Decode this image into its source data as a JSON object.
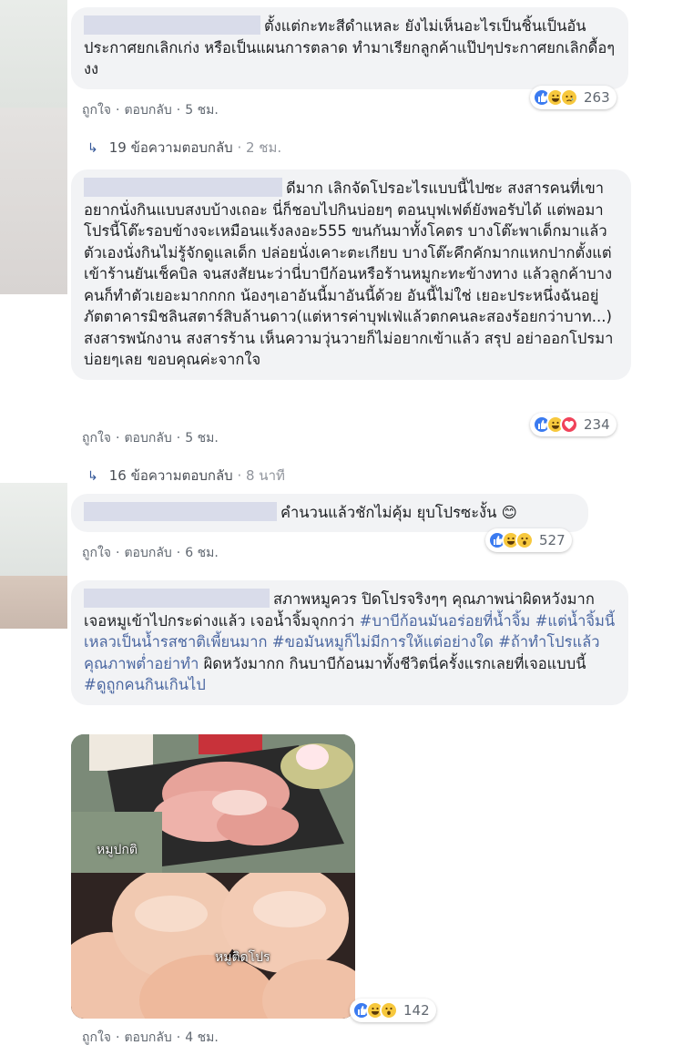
{
  "comments": [
    {
      "text": "ตั้งแต่กะทะสีดำแหละ ยังไม่เห็นอะไรเป็นชิ้นเป็นอัน ประกาศยกเลิกเก่ง หรือเป็นแผนการตลาด ทำมาเรียกลูกค้าแป๊ปๆประกาศยกเลิกดื้อๆ งง",
      "like": "ถูกใจ",
      "reply": "ตอบกลับ",
      "time": "5 ชม.",
      "reactions": [
        "like",
        "haha",
        "sad"
      ],
      "reaction_count": "263",
      "replies": {
        "count": "19 ข้อความตอบกลับ",
        "time": "2 ชม."
      }
    },
    {
      "text": "ดีมาก เลิกจัดโปรอะไรแบบนี้ไปซะ สงสารคนที่เขาอยากนั่งกินแบบสงบบ้างเถอะ นี่ก็ชอบไปกินบ่อยๆ ตอนบุฟเฟต์ยังพอรับได้ แต่พอมาโปรนี้โต๊ะรอบข้างจะเหมือนแร้งลงอะ555 ขนกันมาทั้งโคตร บางโต๊ะพาเด็กมาแล้วตัวเองนั่งกินไม่รู้จักดูแลเด็ก ปล่อยนั่งเคาะตะเกียบ บางโต๊ะคึกคักมากแหกปากตั้งแต่เข้าร้านยันเช็คบิล จนสงสัยนะว่านี่บาบีก้อนหรือร้านหมูกะทะข้างทาง แล้วลูกค้าบางคนก็ทำตัวเยอะมากกกก น้องๆเอาอันนี้มาอันนี้ด้วย อันนี้ไม่ใช่ เยอะประหนึ่งฉันอยู่ภัตตาคารมิชลินสตาร์สิบล้านดาว(แต่หารค่าบุฟเฟ่แล้วตกคนละสองร้อยกว่าบาท...) สงสารพนักงาน สงสารร้าน เห็นความวุ่นวายก็ไม่อยากเข้าแล้ว สรุป อย่าออกโปรมาบ่อยๆเลย ขอบคุณค่ะจากใจ",
      "like": "ถูกใจ",
      "reply": "ตอบกลับ",
      "time": "5 ชม.",
      "reactions": [
        "like",
        "haha",
        "love"
      ],
      "reaction_count": "234",
      "replies": {
        "count": "16 ข้อความตอบกลับ",
        "time": "8 นาที"
      }
    },
    {
      "text": "คำนวนแล้วชักไม่คุ้ม ยุบโปรซะงั้น 😊",
      "like": "ถูกใจ",
      "reply": "ตอบกลับ",
      "time": "6 ชม.",
      "reactions": [
        "like",
        "haha",
        "wow"
      ],
      "reaction_count": "527"
    },
    {
      "text_plain_1": "สภาพหมูควร ปิดโปรจริงๆๆ คุณภาพน่าผิดหวังมาก เจอหมูเข้าไปกระด่างแล้ว เจอน้ำจิ้มจุกกว่า ",
      "tag_1": "#บาบีก้อนมันอร่อยที่น้ำจิ้ม",
      "space_1": " ",
      "tag_2": "#แต่น้ำจิ้มนี้เหลวเป็นน้ำรสชาติเพี้ยนมาก",
      "space_2": " ",
      "tag_3": "#ขอมันหมูก็ไม่มีการให้แต่อย่างใด",
      "space_3": " ",
      "tag_4": "#ถ้าทำโปรแล้วคุณภาพต่ำอย่าทำ",
      "text_plain_2": " ผิดหวังมากก กินบาบีก้อนมาทั้งชีวิตนี่ครั้งแรกเลยที่เจอแบบนี้ ",
      "tag_5": "#ดูถูกคนกินเกินไป",
      "photo_caption_top": "หมูปกติ",
      "photo_caption_bottom": "หมูติดโปร",
      "like": "ถูกใจ",
      "reply": "ตอบกลับ",
      "time": "4 ชม.",
      "reactions": [
        "like",
        "haha",
        "wow"
      ],
      "reaction_count": "142"
    }
  ],
  "colors": {
    "bubble": "#f2f3f5",
    "link": "#365899",
    "hashtag": "#4b67a1",
    "meta": "#606770"
  }
}
